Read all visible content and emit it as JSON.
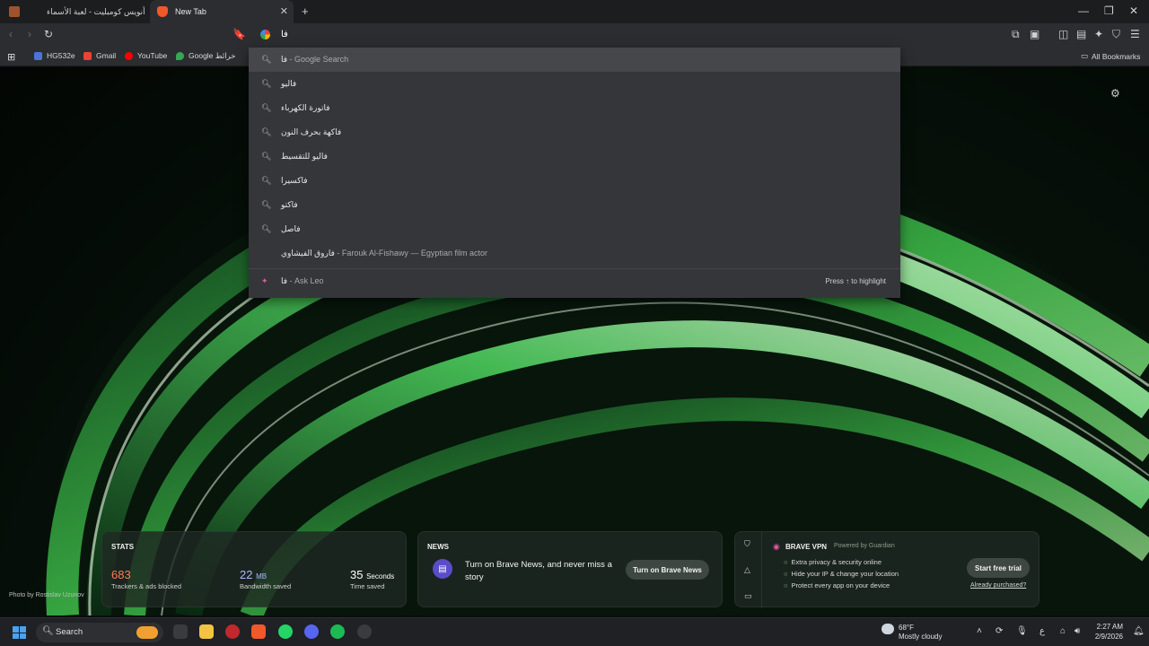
{
  "tabs": [
    {
      "title": "أنويس كومبليت - لعبة الأسماء",
      "icon": "game-favicon"
    },
    {
      "title": "New Tab",
      "icon": "brave-favicon"
    }
  ],
  "toolbar": {
    "address_value": "فا"
  },
  "bookmarks": [
    {
      "label": "HG532e",
      "color": "#4b74d9"
    },
    {
      "label": "Gmail",
      "color": "#ea4335"
    },
    {
      "label": "YouTube",
      "color": "#ff0000"
    },
    {
      "label": "Google خرائط",
      "color": "#34a853"
    }
  ],
  "bookmarks_all": "All Bookmarks",
  "suggestions": [
    {
      "query": "فا",
      "suffix": " - Google Search",
      "icon": "search-icon",
      "selected": true
    },
    {
      "query": "فاليو",
      "suffix": "",
      "icon": "search-icon"
    },
    {
      "query": "فاتورة الكهرباء",
      "suffix": "",
      "icon": "search-icon"
    },
    {
      "query": "فاكهة بحرف النون",
      "suffix": "",
      "icon": "search-icon"
    },
    {
      "query": "فاليو للتقسيط",
      "suffix": "",
      "icon": "search-icon"
    },
    {
      "query": "فاكسيرا",
      "suffix": "",
      "icon": "search-icon"
    },
    {
      "query": "فاكتو",
      "suffix": "",
      "icon": "search-icon"
    },
    {
      "query": "فاصل",
      "suffix": "",
      "icon": "search-icon"
    },
    {
      "query": "فاروق الفيشاوي",
      "suffix": " - Farouk Al-Fishawy — Egyptian film actor",
      "icon": "none"
    },
    {
      "query": "فا",
      "suffix": " - Ask Leo",
      "icon": "leo-icon"
    }
  ],
  "ask_leo_hint": "Press ↑ to highlight",
  "photo_credit": "Photo by Rostislav Uzunov",
  "stats": {
    "title": "STATS",
    "trackers_value": "683",
    "trackers_label": "Trackers & ads blocked",
    "bandwidth_value": "22",
    "bandwidth_unit": "MB",
    "bandwidth_label": "Bandwidth saved",
    "time_value": "35",
    "time_unit": "Seconds",
    "time_label": "Time saved"
  },
  "news": {
    "title": "NEWS",
    "text": "Turn on Brave News, and never miss a story",
    "button": "Turn on Brave News"
  },
  "vpn": {
    "title": "BRAVE VPN",
    "powered": "Powered by Guardian",
    "features": [
      "Extra privacy & security online",
      "Hide your IP & change your location",
      "Protect every app on your device"
    ],
    "button": "Start free trial",
    "link": "Already purchased?"
  },
  "taskbar": {
    "search_label": "Search",
    "weather_temp": "68°F",
    "weather_desc": "Mostly cloudy",
    "time": "2:27 AM",
    "date": "2/9/2026",
    "lang": "ع"
  },
  "colors": {
    "accent_green": "#3fbf4a",
    "stat_orange": "#ff7c5a",
    "stat_blue": "#a9b8ff"
  }
}
